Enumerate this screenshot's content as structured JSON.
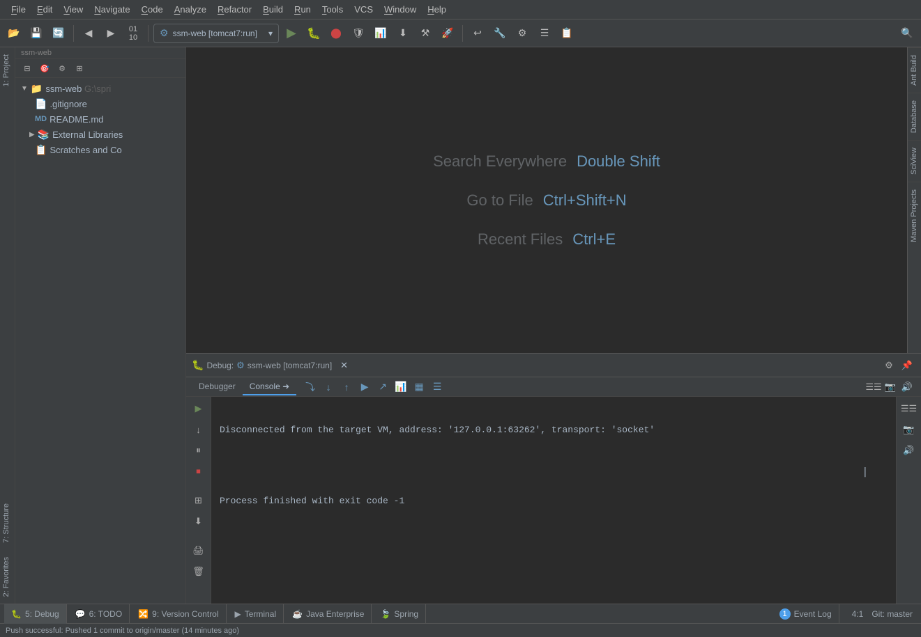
{
  "menubar": {
    "items": [
      "File",
      "Edit",
      "View",
      "Navigate",
      "Code",
      "Analyze",
      "Refactor",
      "Build",
      "Run",
      "Tools",
      "VCS",
      "Window",
      "Help"
    ],
    "underline_chars": [
      "F",
      "E",
      "V",
      "N",
      "C",
      "A",
      "R",
      "B",
      "R",
      "T",
      "V",
      "W",
      "H"
    ]
  },
  "toolbar": {
    "run_config": "ssm-web [tomcat7:run]",
    "run_config_gear": "⚙"
  },
  "project_panel": {
    "title": "1: Project",
    "toolbar_buttons": [
      "⊟",
      "⊕",
      "☰",
      "⊞"
    ],
    "tree": [
      {
        "type": "folder",
        "label": "ssm-web",
        "extra": "G:\\spri",
        "level": 0,
        "expanded": true,
        "selected": false
      },
      {
        "type": "file",
        "label": ".gitignore",
        "level": 1,
        "expanded": false
      },
      {
        "type": "file",
        "label": "README.md",
        "level": 1,
        "icon": "md"
      },
      {
        "type": "folder",
        "label": "External Libraries",
        "level": 1,
        "expanded": false
      },
      {
        "type": "scratch",
        "label": "Scratches and Co",
        "level": 1
      }
    ]
  },
  "editor": {
    "hints": [
      {
        "label": "Search Everywhere",
        "shortcut": "Double Shift"
      },
      {
        "label": "Go to File",
        "shortcut": "Ctrl+Shift+N"
      },
      {
        "label": "Recent Files",
        "shortcut": "Ctrl+E"
      }
    ]
  },
  "right_sidebar": {
    "tabs": [
      "Ant Build",
      "Database",
      "SciView",
      "Maven Projects"
    ]
  },
  "debug_panel": {
    "title": "Debug:",
    "config": "ssm-web [tomcat7:run]",
    "tabs": [
      "Debugger",
      "Console"
    ],
    "active_tab": "Console",
    "console_output": [
      "Disconnected from the target VM, address: '127.0.0.1:63262', transport: 'socket'",
      "",
      "Process finished with exit code -1"
    ]
  },
  "statusbar": {
    "tabs": [
      {
        "icon": "🐛",
        "label": "5: Debug",
        "active": true
      },
      {
        "icon": "💬",
        "label": "6: TODO"
      },
      {
        "icon": "🔀",
        "label": "9: Version Control"
      },
      {
        "icon": "▶",
        "label": "Terminal"
      },
      {
        "icon": "☕",
        "label": "Java Enterprise"
      },
      {
        "icon": "🍃",
        "label": "Spring"
      },
      {
        "icon": "ℹ",
        "label": "Event Log",
        "badge": "1"
      }
    ],
    "position": "4:1",
    "branch": "Git: master"
  },
  "message_bar": {
    "text": "Push successful: Pushed 1 commit to origin/master (14 minutes ago)"
  },
  "left_sidebar_icons": [
    "●",
    "↔",
    "★",
    "◎",
    "≡"
  ],
  "debug_left_btns": [
    "▶",
    "↓",
    "⏸",
    "⏹",
    "⊞",
    "⬇",
    "🖨",
    "🗑"
  ],
  "debug_right_btns": [
    "☰☰",
    "📷",
    "🔊"
  ]
}
